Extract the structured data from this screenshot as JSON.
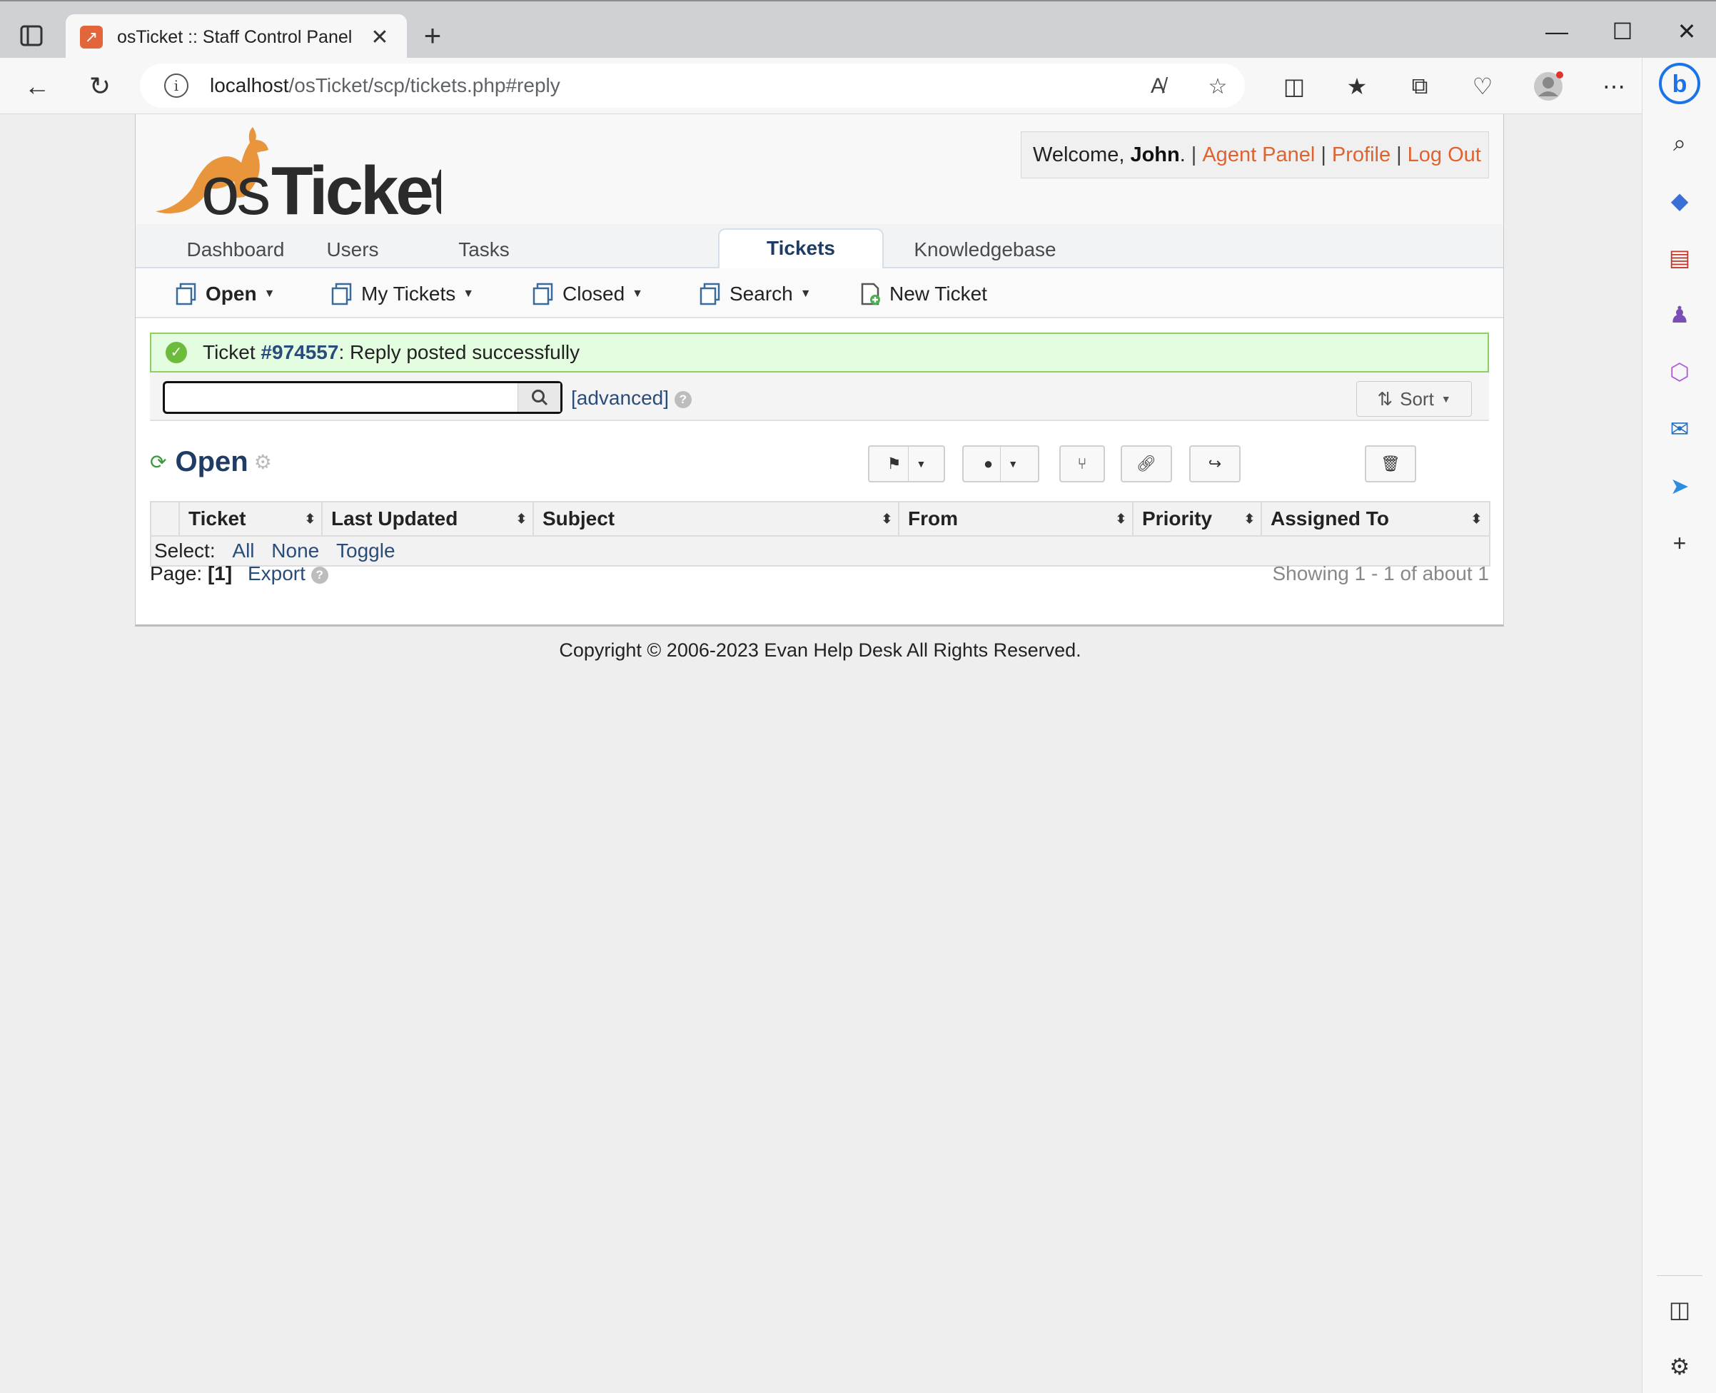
{
  "browser": {
    "tab_title": "osTicket :: Staff Control Panel",
    "url_host": "localhost",
    "url_path": "/osTicket/scp/tickets.php#reply"
  },
  "header": {
    "welcome_prefix": "Welcome, ",
    "user_name": "John",
    "welcome_suffix": ".",
    "separator": "|",
    "agent_panel": "Agent Panel",
    "profile": "Profile",
    "logout": "Log Out"
  },
  "nav": {
    "tabs": [
      "Dashboard",
      "Users",
      "Tasks",
      "Tickets",
      "Knowledgebase"
    ],
    "active": "Tickets"
  },
  "subnav": {
    "open": "Open",
    "my_tickets": "My Tickets",
    "closed": "Closed",
    "search": "Search",
    "new_ticket": "New Ticket"
  },
  "alert": {
    "prefix": "Ticket ",
    "ticket_number": "#974557",
    "message": ": Reply posted successfully"
  },
  "search": {
    "value": "",
    "advanced": "[advanced]",
    "help": "?",
    "sort": "Sort"
  },
  "queue": {
    "title": "Open"
  },
  "table": {
    "columns": [
      "Ticket",
      "Last Updated",
      "Subject",
      "From",
      "Priority",
      "Assigned To"
    ],
    "select_label": "Select:",
    "select_all": "All",
    "select_none": "None",
    "select_toggle": "Toggle"
  },
  "pager": {
    "label": "Page:",
    "current": "[1]",
    "export": "Export",
    "showing": "Showing 1 - 1 of about 1"
  },
  "footer": {
    "copyright": "Copyright © 2006-2023 Evan Help Desk All Rights Reserved."
  },
  "colors": {
    "link_orange": "#e0632f",
    "link_blue": "#2a4c7a",
    "success_bg": "#e4fce0",
    "success_border": "#8fce61",
    "logo_orange": "#e8953c"
  }
}
